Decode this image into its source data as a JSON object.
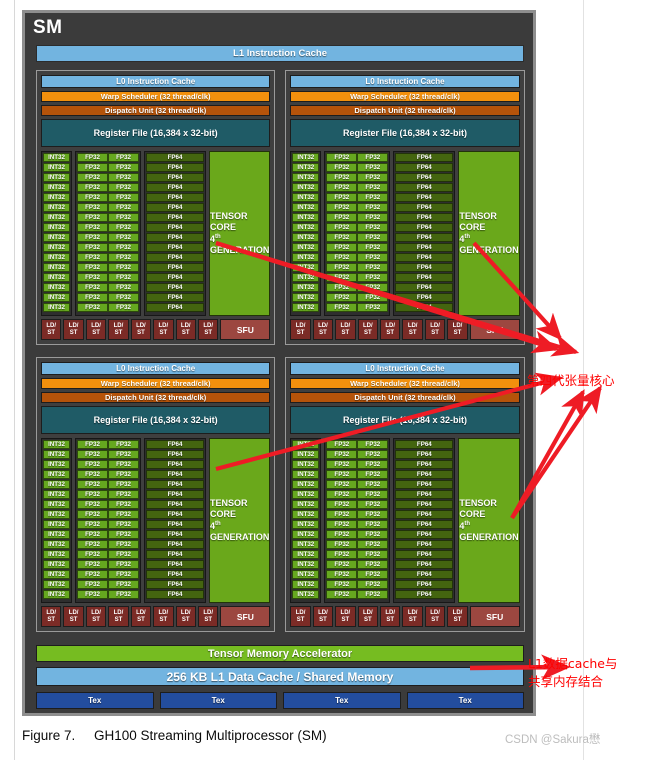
{
  "figure": {
    "label": "Figure 7.",
    "caption": "GH100 Streaming Multiprocessor (SM)",
    "watermark": "CSDN @Sakura懋"
  },
  "sm": {
    "title": "SM",
    "l1_instruction_cache": "L1 Instruction Cache",
    "tensor_memory_accelerator": "Tensor Memory Accelerator",
    "l1_data_cache": "256 KB L1 Data Cache / Shared Memory",
    "tex_label": "Tex",
    "tex_count": 4
  },
  "partition": {
    "l0_instruction_cache": "L0 Instruction Cache",
    "warp_scheduler": "Warp Scheduler (32 thread/clk)",
    "dispatch_unit": "Dispatch Unit (32 thread/clk)",
    "register_file": "Register File (16,384 x 32-bit)",
    "int32": "INT32",
    "fp32": "FP32",
    "fp64": "FP64",
    "core_rows": 16,
    "tensor_core_line1": "TENSOR CORE",
    "tensor_core_gen_num": "4",
    "tensor_core_gen_sup": "th",
    "tensor_core_line2": "GENERATION",
    "ldst_top": "LD/",
    "ldst_bottom": "ST",
    "ldst_count": 8,
    "sfu": "SFU",
    "count": 4
  },
  "annotations": {
    "tensor_core_note": "第四代张量核心",
    "l1_cache_note": "L1数据cache与\n共享内存结合",
    "arrow_color": "#ee1c25"
  },
  "colors": {
    "frame_bg": "#3b3b3b",
    "frame_border": "#8e8e8e",
    "cache_blue": "#72b4e0",
    "warp_orange": "#f2900d",
    "dispatch_brown": "#b5530a",
    "register_teal": "#1f5b66",
    "core_green": "#66a81f",
    "fp64_green": "#44650f",
    "tensor_green": "#6aa81b",
    "ldst_maroon": "#7b2b26",
    "sfu_maroon": "#9c4740",
    "tma_green": "#76bc21",
    "tex_blue": "#234d9e",
    "annotation_red": "#ff0000"
  }
}
